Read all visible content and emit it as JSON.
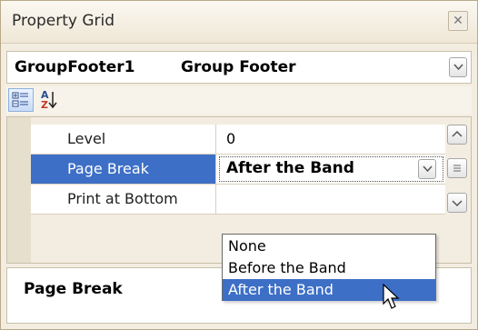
{
  "window": {
    "title": "Property Grid",
    "close_icon": "close-icon"
  },
  "object_selector": {
    "name": "GroupFooter1",
    "type": "Group Footer",
    "dropdown_icon": "chevron-down-icon"
  },
  "toolbar": {
    "categorized_icon": "categorized-icon",
    "alphabetical_icon": "sort-az-icon",
    "alphabetical_text_top": "A",
    "alphabetical_text_bottom": "Z"
  },
  "properties": [
    {
      "name": "Level",
      "value": "0"
    },
    {
      "name": "Page Break",
      "value": "After the Band",
      "selected": true
    },
    {
      "name": "Print at Bottom",
      "value": ""
    }
  ],
  "dropdown": {
    "options": [
      "None",
      "Before the Band",
      "After the Band"
    ],
    "selected": "After the Band"
  },
  "description": {
    "title": "Page Break"
  },
  "colors": {
    "selection": "#3d6fc6",
    "panel_background": "#f3ede1",
    "border": "#b9a98a"
  }
}
